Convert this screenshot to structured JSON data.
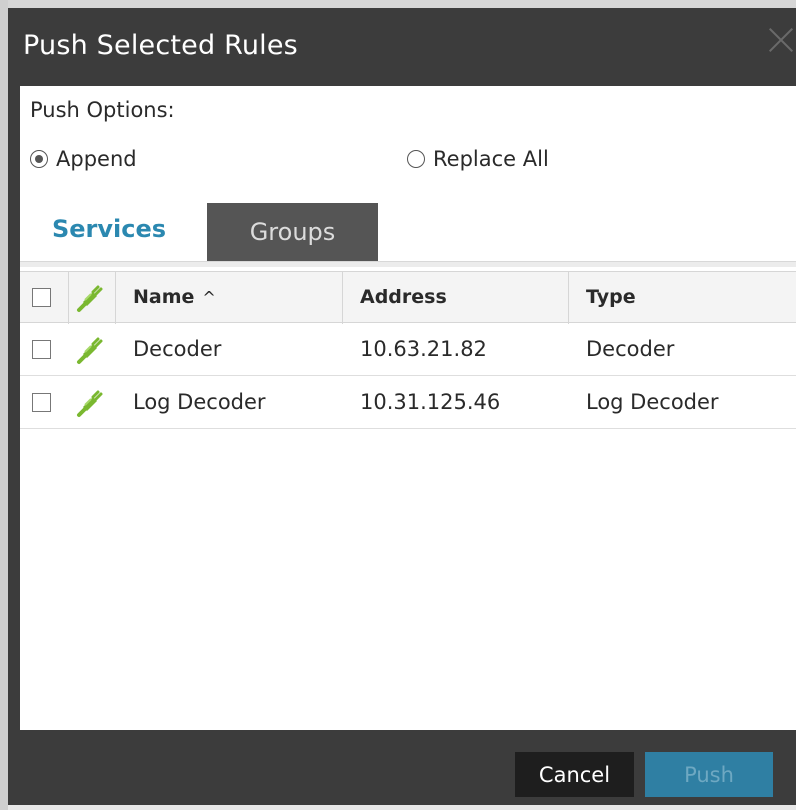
{
  "dialog": {
    "title": "Push Selected Rules",
    "push_options_label": "Push Options:",
    "radio_append": "Append",
    "radio_replace_all": "Replace All",
    "append_selected": true
  },
  "tabs": [
    {
      "label": "Services",
      "active": true
    },
    {
      "label": "Groups",
      "active": false
    }
  ],
  "grid": {
    "columns": [
      "Name",
      "Address",
      "Type"
    ],
    "sort_indicator": "^",
    "rows": [
      {
        "name": "Decoder",
        "address": "10.63.21.82",
        "type": "Decoder"
      },
      {
        "name": "Log Decoder",
        "address": "10.31.125.46",
        "type": "Log Decoder"
      }
    ]
  },
  "footer": {
    "cancel_label": "Cancel",
    "push_label": "Push"
  },
  "colors": {
    "dialog_bg": "#3c3c3c",
    "active_tab_text": "#2b88b0",
    "push_button": "#2f7fa3",
    "plug_icon": "#7ab830"
  },
  "icons": {
    "close": "close-icon",
    "service": "plug-icon"
  }
}
